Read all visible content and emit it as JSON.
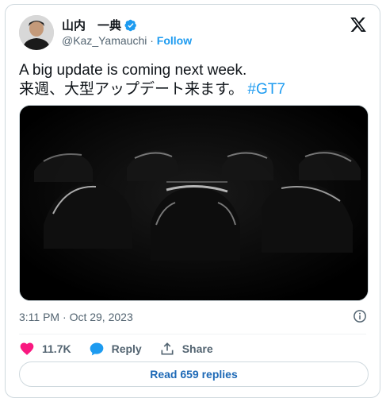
{
  "author": {
    "display_name": "山内　一典",
    "handle": "@Kaz_Yamauchi",
    "separator": "·",
    "follow_label": "Follow",
    "verified_icon": "verified-badge-icon",
    "avatar_icon": "avatar"
  },
  "platform_icon": "x-logo-icon",
  "tweet": {
    "line1": "A big update is coming next week.",
    "line2_text": "来週、大型アップデート来ます。",
    "hashtag": "#GT7"
  },
  "media": {
    "description_icon": "cars-silhouette-image"
  },
  "meta": {
    "time": "3:11 PM",
    "separator": "·",
    "date": "Oct 29, 2023",
    "info_icon": "info-icon"
  },
  "actions": {
    "like_count": "11.7K",
    "reply_label": "Reply",
    "share_label": "Share"
  },
  "replies_button": "Read 659 replies",
  "colors": {
    "accent": "#1d9bf0",
    "like": "#f91880",
    "reply": "#1d9bf0",
    "border": "#cfd9de",
    "muted": "#536471"
  }
}
